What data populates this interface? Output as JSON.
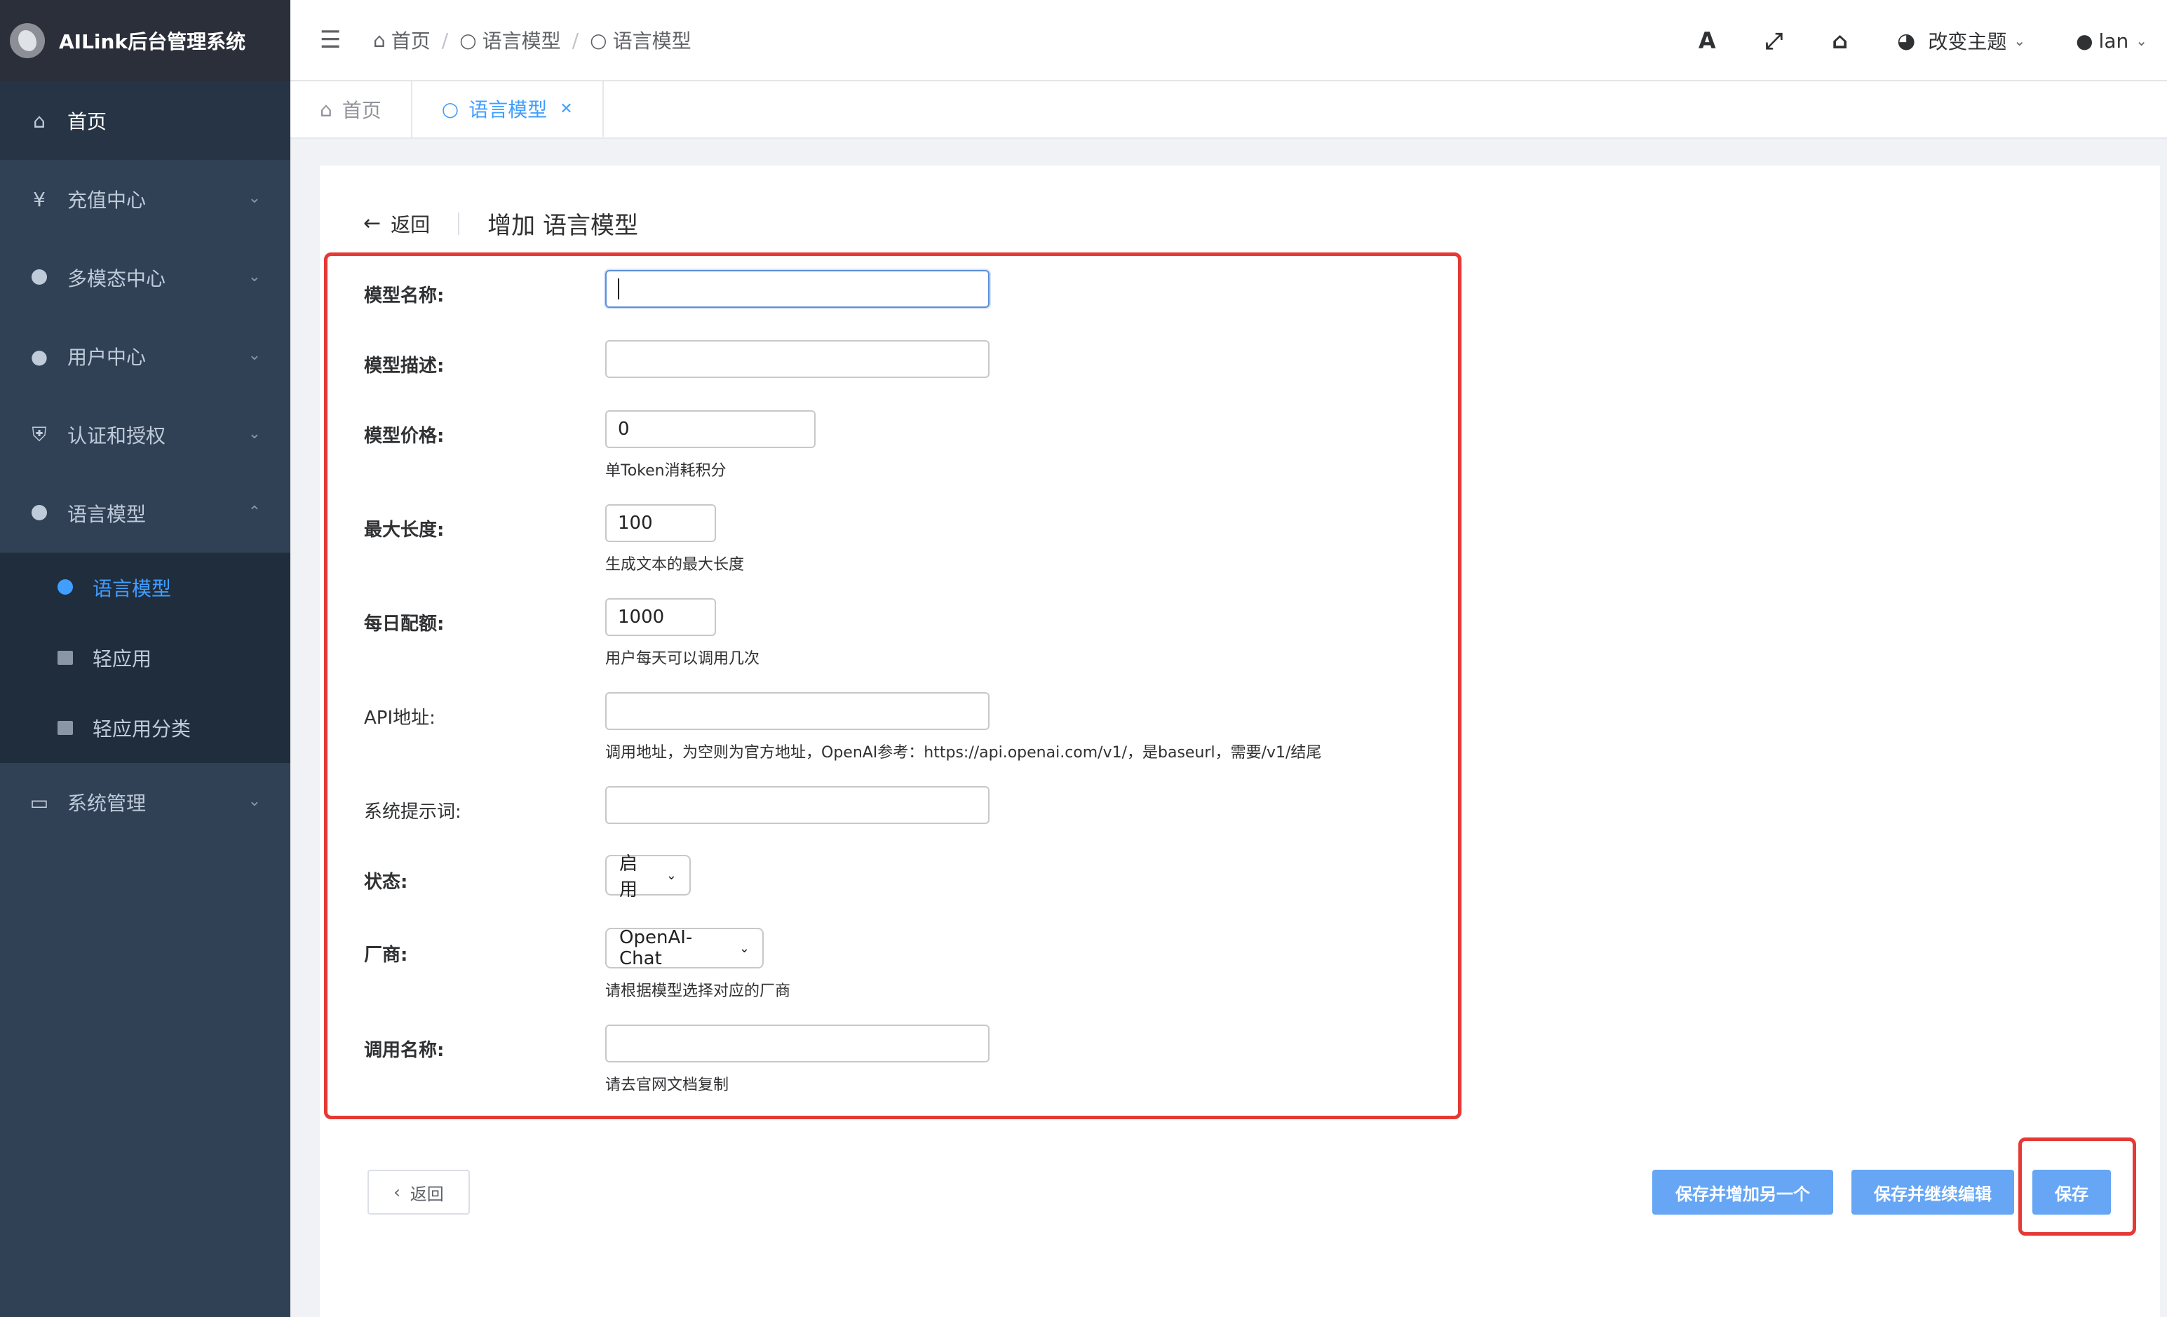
{
  "app": {
    "title": "AILink后台管理系统"
  },
  "sidebar": {
    "items": [
      {
        "label": "首页",
        "icon": "home-icon"
      },
      {
        "label": "充值中心",
        "icon": "yen-icon"
      },
      {
        "label": "多模态中心",
        "icon": "circle-icon"
      },
      {
        "label": "用户中心",
        "icon": "user-icon"
      },
      {
        "label": "认证和授权",
        "icon": "shield-icon"
      },
      {
        "label": "语言模型",
        "icon": "circle-icon"
      },
      {
        "label": "系统管理",
        "icon": "monitor-icon"
      }
    ],
    "submenu": [
      {
        "label": "语言模型"
      },
      {
        "label": "轻应用"
      },
      {
        "label": "轻应用分类"
      }
    ]
  },
  "navbar": {
    "breadcrumb": [
      "首页",
      "语言模型",
      "语言模型"
    ],
    "font_icon": "A",
    "theme_label": "改变主题",
    "user_name": "lan"
  },
  "tags": [
    {
      "label": "首页"
    },
    {
      "label": "语言模型"
    }
  ],
  "page": {
    "back_label": "返回",
    "title": "增加 语言模型"
  },
  "form": {
    "model_name": {
      "label": "模型名称:",
      "value": ""
    },
    "model_desc": {
      "label": "模型描述:",
      "value": ""
    },
    "model_price": {
      "label": "模型价格:",
      "value": "0",
      "help": "单Token消耗积分"
    },
    "max_length": {
      "label": "最大长度:",
      "value": "100",
      "help": "生成文本的最大长度"
    },
    "daily_quota": {
      "label": "每日配额:",
      "value": "1000",
      "help": "用户每天可以调用几次"
    },
    "api_url": {
      "label": "API地址:",
      "value": "",
      "help": "调用地址，为空则为官方地址，OpenAI参考：https://api.openai.com/v1/，是baseurl，需要/v1/结尾"
    },
    "system_prompt": {
      "label": "系统提示词:",
      "value": ""
    },
    "status": {
      "label": "状态:",
      "value": "启用"
    },
    "vendor": {
      "label": "厂商:",
      "value": "OpenAI-Chat",
      "help": "请根据模型选择对应的厂商"
    },
    "call_name": {
      "label": "调用名称:",
      "value": "",
      "help": "请去官网文档复制"
    }
  },
  "actions": {
    "back": "返回",
    "save_add_another": "保存并增加另一个",
    "save_continue": "保存并继续编辑",
    "save": "保存"
  },
  "colors": {
    "sidebar_bg": "#304156",
    "accent": "#409eff",
    "primary_button": "#66a6f5",
    "highlight_border": "#e53935"
  }
}
